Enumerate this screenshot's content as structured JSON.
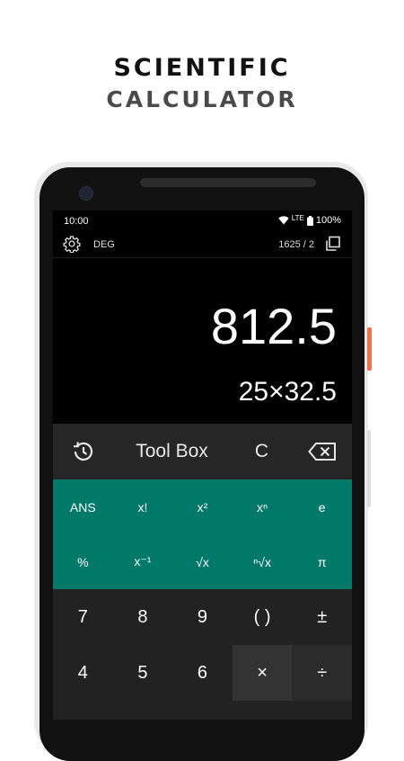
{
  "promo": {
    "title_line1": "SCIENTIFIC",
    "title_line2": "CALCULATOR"
  },
  "status_bar": {
    "time": "10:00",
    "network": "LTE",
    "battery": "100%"
  },
  "toolbar": {
    "angle_mode": "DEG",
    "memory_counter": "1625 / 2"
  },
  "display": {
    "result": "812.5",
    "expression": "25×32.5"
  },
  "tool_row": {
    "toolbox_label": "Tool Box",
    "clear_label": "C"
  },
  "scientific_keys": [
    "ANS",
    "x!",
    "x²",
    "xⁿ",
    "e",
    "%",
    "x⁻¹",
    "√x",
    "ⁿ√x",
    "π"
  ],
  "number_keys": [
    "7",
    "8",
    "9",
    "( )",
    "±",
    "4",
    "5",
    "6",
    "×",
    "÷"
  ],
  "colors": {
    "accent_teal": "#00796b",
    "screen_bg": "#000000",
    "key_bg": "#222222",
    "side_button": "#f0714b"
  },
  "icons": [
    "settings-gear-icon",
    "copy-icon",
    "history-icon",
    "backspace-icon",
    "wifi-icon",
    "battery-icon"
  ]
}
